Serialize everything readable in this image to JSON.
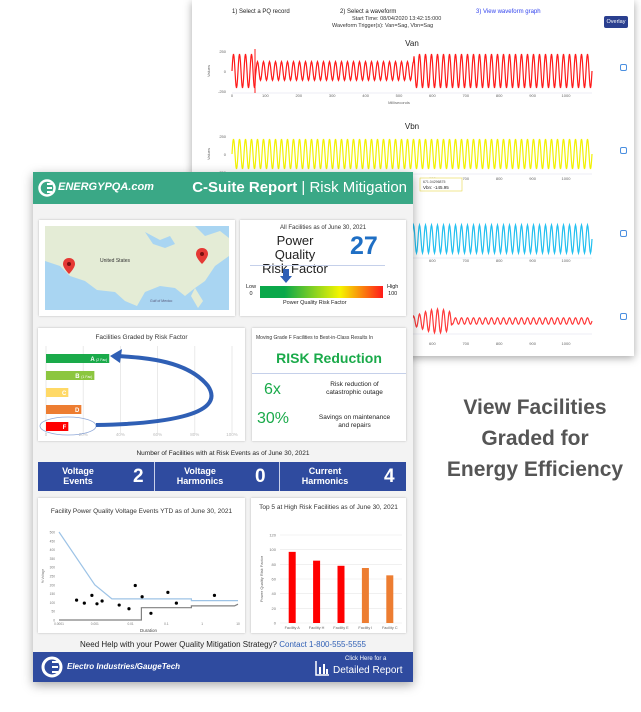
{
  "waveform_panel": {
    "steps": [
      "1) Select a PQ record",
      "2) Select a waveform",
      "3) View waveform graph"
    ],
    "start_time": "Start Time: 08/04/2020 13:42:15:000",
    "trigger": "Waveform Trigger(s): Van=Sag, Vbn=Sag",
    "overlay_label": "Overlay",
    "charts": [
      {
        "title": "Van",
        "color": "#ff1a1a",
        "ylabel": "Values",
        "yticks": [
          "250",
          "0",
          "-250"
        ],
        "xlabel": "Milliseconds"
      },
      {
        "title": "Vbn",
        "color": "#f2f200",
        "ylabel": "Values",
        "yticks": [
          "250",
          "0",
          "-250"
        ],
        "xlabel": "Milliseconds"
      },
      {
        "title": "",
        "color": "#22c0f0",
        "xlabel": "Milliseconds"
      },
      {
        "title": "",
        "color": "#ff3a3a"
      }
    ],
    "xticks": [
      "0",
      "100",
      "200",
      "300",
      "400",
      "500",
      "600",
      "700",
      "800",
      "900",
      "1000"
    ],
    "tooltip": {
      "x": "671.04296875",
      "series": "Vbn:",
      "value": "-145.95"
    }
  },
  "side_text": [
    "View Facilities",
    "Graded for",
    "Energy Efficiency"
  ],
  "report": {
    "brand": "ENERGYPQA.com",
    "title_bold": "C-Suite Report",
    "title_sep": "|",
    "title_light": "Risk Mitigation",
    "map": {
      "country_label": "United States",
      "gulf_label": "Gulf of Mexico"
    },
    "risk": {
      "caption": "All Facilities as of June 30, 2021",
      "label_line1": "Power Quality",
      "label_line2": "Risk Factor",
      "value": 27,
      "scale_low": "Low",
      "scale_low_val": "0",
      "scale_high": "High",
      "scale_high_val": "100",
      "scale_caption": "Power Quality Risk Factor",
      "scale_colors": [
        "#0aa84a",
        "#f5f500",
        "#ff1a1a"
      ]
    },
    "grades": {
      "title": "Facilities Graded by Risk Factor",
      "bars": [
        {
          "label": "A",
          "note": "(2 Fac)",
          "percent": 34,
          "color": "#1aaa4a"
        },
        {
          "label": "B",
          "note": "(1 Fac)",
          "percent": 26,
          "color": "#8cc63f"
        },
        {
          "label": "C",
          "note": "",
          "percent": 12,
          "color": "#ffd966"
        },
        {
          "label": "D",
          "note": "",
          "percent": 19,
          "color": "#ed7d31"
        },
        {
          "label": "F",
          "note": "",
          "percent": 12,
          "color": "#ff0000"
        }
      ],
      "xticks": [
        "0",
        "20%",
        "40%",
        "60%",
        "80%",
        "100%"
      ]
    },
    "reduction": {
      "caption": "Moving Grade F Facilities to Best-in-Class Results In",
      "headline": "RISK Reduction",
      "items": [
        {
          "value": "6x",
          "text1": "Risk reduction of",
          "text2": "catastrophic outage"
        },
        {
          "value": "30%",
          "text1": "Savings on maintenance",
          "text2": "and repairs"
        }
      ]
    },
    "events_caption": "Number of Facilities with at Risk Events as of June 30, 2021",
    "kpis": [
      {
        "l1": "Voltage",
        "l2": "Events",
        "value": "2"
      },
      {
        "l1": "Voltage",
        "l2": "Harmonics",
        "value": "0"
      },
      {
        "l1": "Current",
        "l2": "Harmonics",
        "value": "4"
      }
    ],
    "help_text": "Need Help with your Power Quality Mitigation Strategy?",
    "contact_text": "Contact 1-800-555-5555",
    "footer_brand": "Electro Industries/GaugeTech",
    "detail_line1": "Click Here for a",
    "detail_line2": "Detailed Report"
  },
  "chart_data": [
    {
      "type": "scatter",
      "title": "Facility Power Quality Voltage Events YTD as of June 30, 2021",
      "xlabel": "Duration",
      "ylabel": "% Voltage",
      "xscale": "log",
      "xlim": [
        0.0001,
        10
      ],
      "ylim": [
        0,
        500
      ],
      "xticks": [
        "0.0001",
        "0.001",
        "0.01",
        "0.1",
        "1",
        "10"
      ],
      "yticks": [
        "0",
        "50",
        "100",
        "150",
        "200",
        "250",
        "300",
        "350",
        "400",
        "450",
        "500"
      ],
      "points": [
        [
          0.00031,
          113
        ],
        [
          0.00051,
          96
        ],
        [
          0.00083,
          140
        ],
        [
          0.00115,
          92
        ],
        [
          0.0016,
          108
        ],
        [
          0.0048,
          85
        ],
        [
          0.009,
          64
        ],
        [
          0.0135,
          196
        ],
        [
          0.021,
          132
        ],
        [
          0.037,
          38
        ],
        [
          0.11,
          157
        ],
        [
          0.19,
          96
        ],
        [
          2.2,
          140
        ]
      ],
      "upper_envelope": [
        [
          0.0001,
          500
        ],
        [
          0.001,
          200
        ],
        [
          0.003,
          120
        ],
        [
          0.5,
          120
        ],
        [
          0.5,
          110
        ],
        [
          10,
          110
        ]
      ],
      "lower_envelope": [
        [
          0.0001,
          0
        ],
        [
          0.02,
          0
        ],
        [
          0.02,
          70
        ],
        [
          0.5,
          70
        ],
        [
          0.5,
          80
        ],
        [
          8,
          80
        ],
        [
          10,
          90
        ]
      ],
      "colors": {
        "points": "#000000",
        "upper": "#9dc3e6",
        "lower": "#808080"
      }
    },
    {
      "type": "bar",
      "title": "Top 5 at High Risk Facilities as of June 30, 2021",
      "ylabel": "Power Quality Risk Factor",
      "ylim": [
        0,
        120
      ],
      "yticks": [
        "0",
        "20",
        "40",
        "60",
        "80",
        "100",
        "120"
      ],
      "categories": [
        "Facility A",
        "Facility H",
        "Facility E",
        "Facility I",
        "Facility C"
      ],
      "values": [
        97,
        85,
        78,
        75,
        65
      ],
      "colors": [
        "#ff0000",
        "#ff0000",
        "#ff0000",
        "#ed7d31",
        "#ed7d31"
      ]
    }
  ]
}
